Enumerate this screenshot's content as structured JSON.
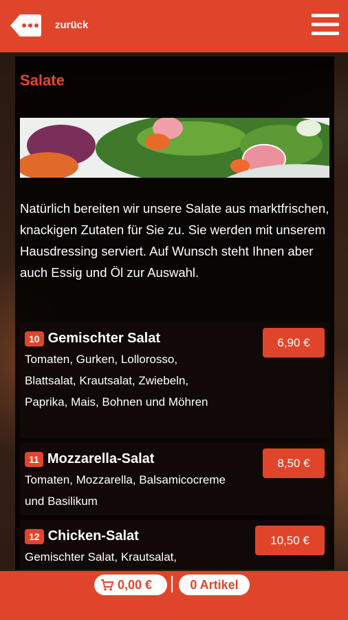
{
  "header": {
    "back_label": "zurück",
    "back_icon": "more-dots-icon",
    "menu_icon": "hamburger-menu-icon"
  },
  "category": {
    "title": "Salate",
    "banner_image": "salad-banner",
    "intro": "Natürlich bereiten wir unsere Salate aus marktfrischen, knackigen Zutaten für Sie zu. Sie werden mit unserem Hausdressing serviert. Auf Wunsch steht Ihnen aber auch Essig und Öl zur Auswahl."
  },
  "items": [
    {
      "number": "10",
      "name": "Gemischter Salat",
      "description": "Tomaten, Gurken, Lollorosso, Blattsalat, Krautsalat, Zwiebeln, Paprika, Mais, Bohnen und Möhren",
      "price": "6,90 €"
    },
    {
      "number": "11",
      "name": "Mozzarella-Salat",
      "description": "Tomaten, Mozzarella, Balsamicocreme und Basilikum",
      "price": "8,50 €"
    },
    {
      "number": "12",
      "name": "Chicken-Salat",
      "description": "Gemischter Salat, Krautsalat,",
      "price": "10,50 €"
    }
  ],
  "footer": {
    "cart_icon": "shopping-cart-icon",
    "cart_total": "0,00 €",
    "separator": "|",
    "item_count": "0 Artikel"
  },
  "colors": {
    "accent": "#e0452b",
    "panel": "#000000",
    "text": "#ffffff"
  }
}
